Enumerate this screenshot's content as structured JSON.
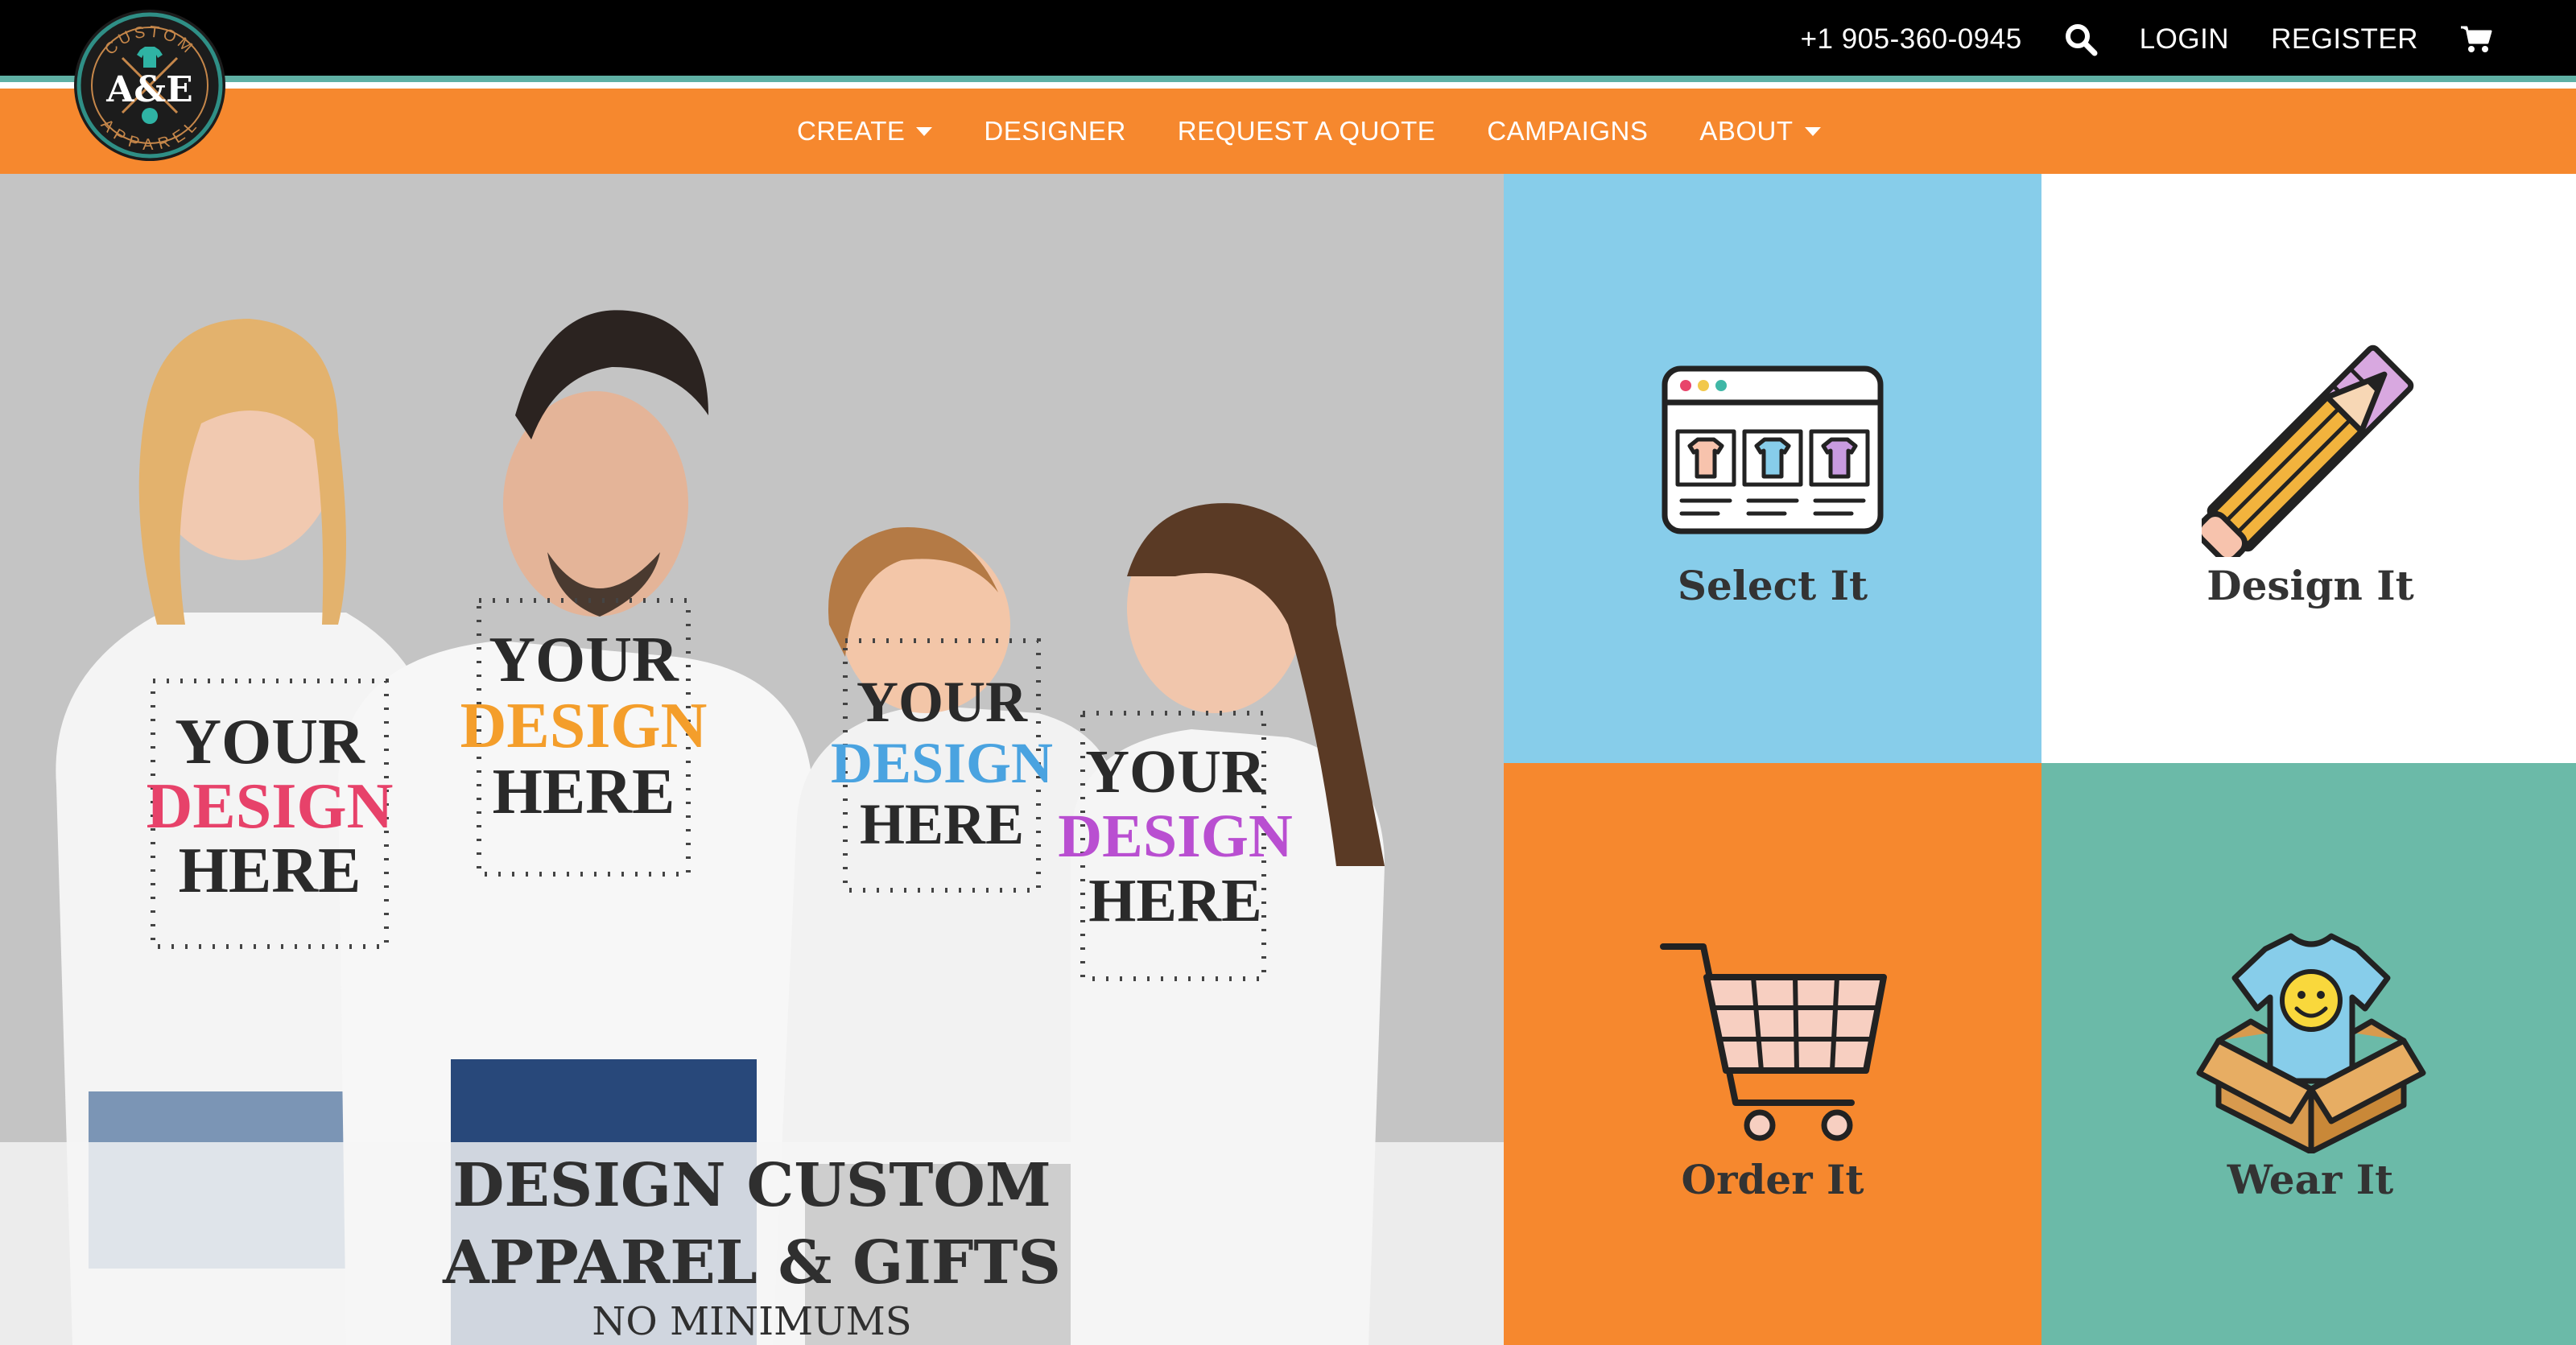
{
  "header": {
    "phone": "+1 905-360-0945",
    "search_icon": "search-icon",
    "login_label": "LOGIN",
    "register_label": "REGISTER",
    "cart_icon": "cart-icon"
  },
  "logo": {
    "top_text": "CUSTOM",
    "center_text": "A&E",
    "bottom_text": "APPAREL"
  },
  "nav": {
    "items": [
      {
        "label": "CREATE",
        "has_dropdown": true
      },
      {
        "label": "DESIGNER",
        "has_dropdown": false
      },
      {
        "label": "REQUEST A QUOTE",
        "has_dropdown": false
      },
      {
        "label": "CAMPAIGNS",
        "has_dropdown": false
      },
      {
        "label": "ABOUT",
        "has_dropdown": true
      }
    ]
  },
  "hero": {
    "shirt_text": [
      "YOUR",
      "DESIGN",
      "HERE"
    ],
    "headline_line1": "DESIGN CUSTOM",
    "headline_line2": "APPAREL & GIFTS",
    "subline": "NO MINIMUMS"
  },
  "steps": [
    {
      "label": "Select It",
      "icon": "browser-shirts-icon"
    },
    {
      "label": "Design It",
      "icon": "pencil-ruler-icon"
    },
    {
      "label": "Order It",
      "icon": "shopping-cart-icon"
    },
    {
      "label": "Wear It",
      "icon": "shirt-box-icon"
    }
  ],
  "colors": {
    "top_bar": "#000000",
    "accent_stripe": "#5fb0a4",
    "nav_orange": "#f6882e",
    "tile_blue": "#87cdea",
    "tile_white": "#ffffff",
    "tile_orange": "#f6882e",
    "tile_teal": "#6bbaa8"
  }
}
